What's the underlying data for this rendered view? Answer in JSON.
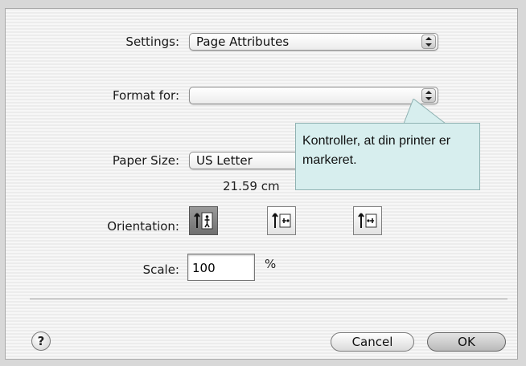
{
  "settings": {
    "label": "Settings:",
    "value": "Page Attributes"
  },
  "format_for": {
    "label": "Format for:",
    "value": ""
  },
  "paper_size": {
    "label": "Paper Size:",
    "value": "US Letter",
    "dimensions": "21.59 cm"
  },
  "orientation": {
    "label": "Orientation:",
    "options": [
      {
        "name": "portrait",
        "selected": true
      },
      {
        "name": "landscape-left",
        "selected": false
      },
      {
        "name": "landscape-right",
        "selected": false
      }
    ]
  },
  "scale": {
    "label": "Scale:",
    "value": "100",
    "unit": "%"
  },
  "buttons": {
    "help": "?",
    "cancel": "Cancel",
    "ok": "OK"
  },
  "tooltip": {
    "text": "Kontroller, at din printer er markeret."
  }
}
